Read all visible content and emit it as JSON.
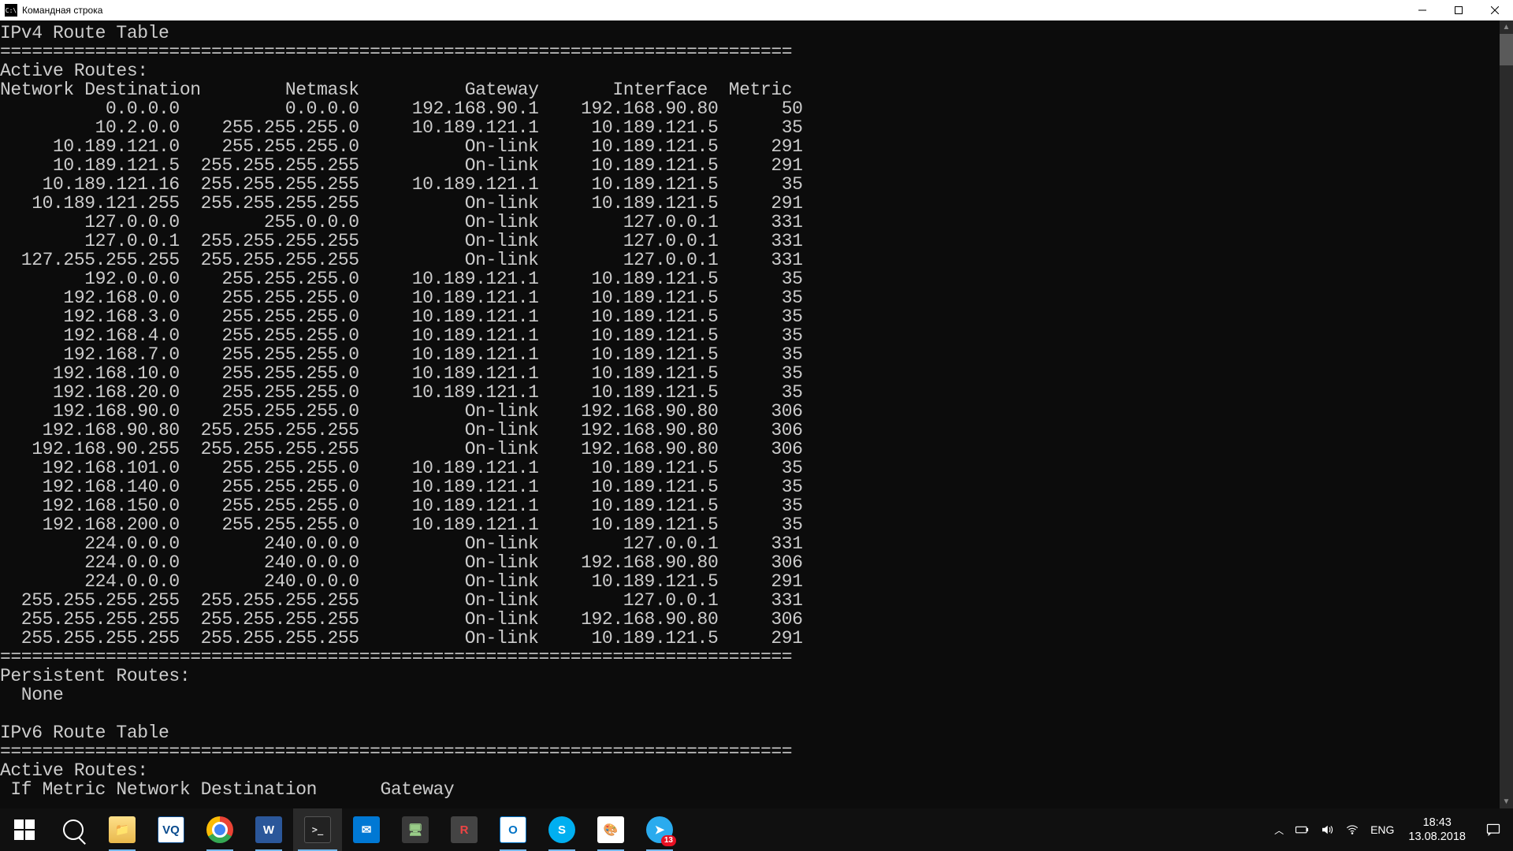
{
  "window": {
    "title": "Командная строка"
  },
  "terminal": {
    "ipv4_header": "IPv4 Route Table",
    "separator": "===========================================================================",
    "active_routes_label": "Active Routes:",
    "columns": [
      "Network Destination",
      "Netmask",
      "Gateway",
      "Interface",
      "Metric"
    ],
    "routes": [
      {
        "dest": "0.0.0.0",
        "mask": "0.0.0.0",
        "gateway": "192.168.90.1",
        "iface": "192.168.90.80",
        "metric": "50"
      },
      {
        "dest": "10.2.0.0",
        "mask": "255.255.255.0",
        "gateway": "10.189.121.1",
        "iface": "10.189.121.5",
        "metric": "35"
      },
      {
        "dest": "10.189.121.0",
        "mask": "255.255.255.0",
        "gateway": "On-link",
        "iface": "10.189.121.5",
        "metric": "291"
      },
      {
        "dest": "10.189.121.5",
        "mask": "255.255.255.255",
        "gateway": "On-link",
        "iface": "10.189.121.5",
        "metric": "291"
      },
      {
        "dest": "10.189.121.16",
        "mask": "255.255.255.255",
        "gateway": "10.189.121.1",
        "iface": "10.189.121.5",
        "metric": "35"
      },
      {
        "dest": "10.189.121.255",
        "mask": "255.255.255.255",
        "gateway": "On-link",
        "iface": "10.189.121.5",
        "metric": "291"
      },
      {
        "dest": "127.0.0.0",
        "mask": "255.0.0.0",
        "gateway": "On-link",
        "iface": "127.0.0.1",
        "metric": "331"
      },
      {
        "dest": "127.0.0.1",
        "mask": "255.255.255.255",
        "gateway": "On-link",
        "iface": "127.0.0.1",
        "metric": "331"
      },
      {
        "dest": "127.255.255.255",
        "mask": "255.255.255.255",
        "gateway": "On-link",
        "iface": "127.0.0.1",
        "metric": "331"
      },
      {
        "dest": "192.0.0.0",
        "mask": "255.255.255.0",
        "gateway": "10.189.121.1",
        "iface": "10.189.121.5",
        "metric": "35"
      },
      {
        "dest": "192.168.0.0",
        "mask": "255.255.255.0",
        "gateway": "10.189.121.1",
        "iface": "10.189.121.5",
        "metric": "35"
      },
      {
        "dest": "192.168.3.0",
        "mask": "255.255.255.0",
        "gateway": "10.189.121.1",
        "iface": "10.189.121.5",
        "metric": "35"
      },
      {
        "dest": "192.168.4.0",
        "mask": "255.255.255.0",
        "gateway": "10.189.121.1",
        "iface": "10.189.121.5",
        "metric": "35"
      },
      {
        "dest": "192.168.7.0",
        "mask": "255.255.255.0",
        "gateway": "10.189.121.1",
        "iface": "10.189.121.5",
        "metric": "35"
      },
      {
        "dest": "192.168.10.0",
        "mask": "255.255.255.0",
        "gateway": "10.189.121.1",
        "iface": "10.189.121.5",
        "metric": "35"
      },
      {
        "dest": "192.168.20.0",
        "mask": "255.255.255.0",
        "gateway": "10.189.121.1",
        "iface": "10.189.121.5",
        "metric": "35"
      },
      {
        "dest": "192.168.90.0",
        "mask": "255.255.255.0",
        "gateway": "On-link",
        "iface": "192.168.90.80",
        "metric": "306"
      },
      {
        "dest": "192.168.90.80",
        "mask": "255.255.255.255",
        "gateway": "On-link",
        "iface": "192.168.90.80",
        "metric": "306"
      },
      {
        "dest": "192.168.90.255",
        "mask": "255.255.255.255",
        "gateway": "On-link",
        "iface": "192.168.90.80",
        "metric": "306"
      },
      {
        "dest": "192.168.101.0",
        "mask": "255.255.255.0",
        "gateway": "10.189.121.1",
        "iface": "10.189.121.5",
        "metric": "35"
      },
      {
        "dest": "192.168.140.0",
        "mask": "255.255.255.0",
        "gateway": "10.189.121.1",
        "iface": "10.189.121.5",
        "metric": "35"
      },
      {
        "dest": "192.168.150.0",
        "mask": "255.255.255.0",
        "gateway": "10.189.121.1",
        "iface": "10.189.121.5",
        "metric": "35"
      },
      {
        "dest": "192.168.200.0",
        "mask": "255.255.255.0",
        "gateway": "10.189.121.1",
        "iface": "10.189.121.5",
        "metric": "35"
      },
      {
        "dest": "224.0.0.0",
        "mask": "240.0.0.0",
        "gateway": "On-link",
        "iface": "127.0.0.1",
        "metric": "331"
      },
      {
        "dest": "224.0.0.0",
        "mask": "240.0.0.0",
        "gateway": "On-link",
        "iface": "192.168.90.80",
        "metric": "306"
      },
      {
        "dest": "224.0.0.0",
        "mask": "240.0.0.0",
        "gateway": "On-link",
        "iface": "10.189.121.5",
        "metric": "291"
      },
      {
        "dest": "255.255.255.255",
        "mask": "255.255.255.255",
        "gateway": "On-link",
        "iface": "127.0.0.1",
        "metric": "331"
      },
      {
        "dest": "255.255.255.255",
        "mask": "255.255.255.255",
        "gateway": "On-link",
        "iface": "192.168.90.80",
        "metric": "306"
      },
      {
        "dest": "255.255.255.255",
        "mask": "255.255.255.255",
        "gateway": "On-link",
        "iface": "10.189.121.5",
        "metric": "291"
      }
    ],
    "persistent_label": "Persistent Routes:",
    "persistent_none": "  None",
    "ipv6_header": "IPv6 Route Table",
    "ipv6_columns_line": " If Metric Network Destination      Gateway"
  },
  "taskbar": {
    "apps": [
      {
        "name": "start",
        "label": ""
      },
      {
        "name": "search",
        "label": ""
      },
      {
        "name": "file-explorer",
        "label": ""
      },
      {
        "name": "vnc",
        "label": "VQ"
      },
      {
        "name": "chrome",
        "label": ""
      },
      {
        "name": "word",
        "label": "W"
      },
      {
        "name": "cmd",
        "label": ">_"
      },
      {
        "name": "mail",
        "label": "✉"
      },
      {
        "name": "vmware",
        "label": "🖥"
      },
      {
        "name": "revit",
        "label": "R"
      },
      {
        "name": "outlook",
        "label": "O"
      },
      {
        "name": "skype",
        "label": "S"
      },
      {
        "name": "paint",
        "label": "🎨"
      },
      {
        "name": "telegram",
        "label": "➤",
        "badge": "13"
      }
    ],
    "lang": "ENG",
    "time": "18:43",
    "date": "13.08.2018"
  }
}
